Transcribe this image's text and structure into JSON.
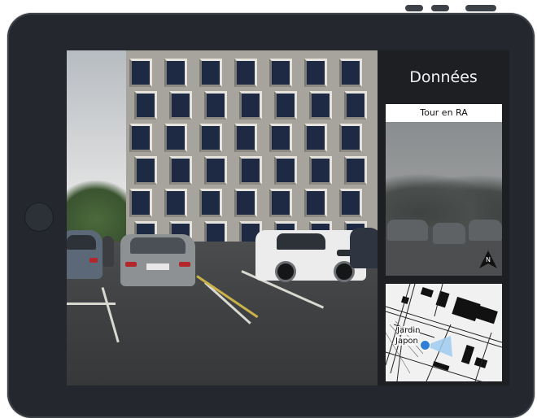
{
  "panel": {
    "title": "Données",
    "ar_view": {
      "header": "Tour en RA",
      "icon": "compass-arrow-icon"
    },
    "map": {
      "label_line1": "Jardin",
      "label_line2": "Japon",
      "icon": "location-marker-icon"
    }
  },
  "colors": {
    "bezel": "#24282e",
    "panel_background": "#1d1f23",
    "location_marker": "#2f7fd6"
  }
}
